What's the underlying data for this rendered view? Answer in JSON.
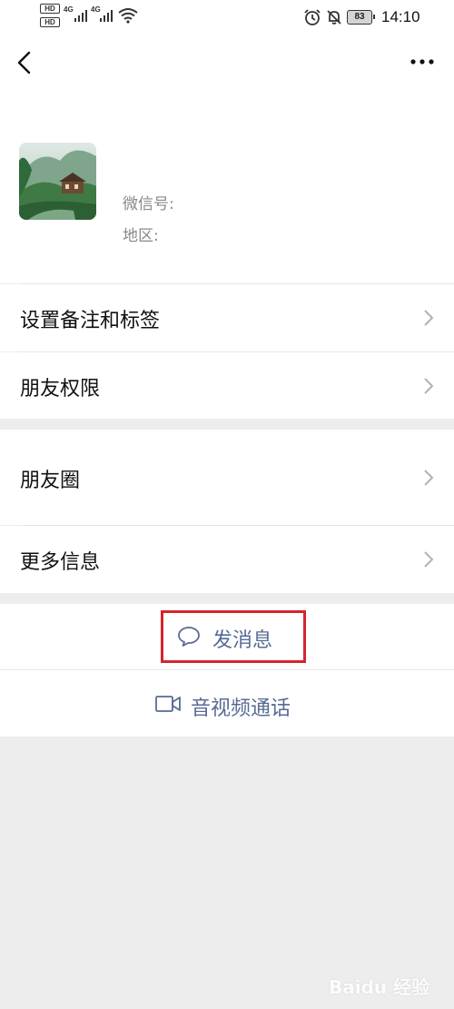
{
  "status_bar": {
    "hd_label": "HD",
    "network_1": "4G",
    "network_2": "4G",
    "battery": "83",
    "time": "14:10"
  },
  "header": {
    "back_icon": "chevron-left-icon",
    "more_icon": "more-dots-icon",
    "wechat_id_label": "微信号:",
    "region_label": "地区:"
  },
  "menu": {
    "group1": [
      {
        "label": "设置备注和标签",
        "icon": "chevron-right-icon"
      },
      {
        "label": "朋友权限",
        "icon": "chevron-right-icon"
      }
    ],
    "group2": [
      {
        "label": "朋友圈",
        "icon": "chevron-right-icon"
      },
      {
        "label": "更多信息",
        "icon": "chevron-right-icon"
      }
    ]
  },
  "actions": {
    "send_message": "发消息",
    "send_message_icon": "chat-bubble-icon",
    "video_call": "音视频通话",
    "video_call_icon": "video-camera-icon"
  },
  "watermark": {
    "text": "Baidu 经验"
  },
  "colors": {
    "background": "#ededed",
    "link_blue": "#576b95",
    "highlight_red": "#d4252b"
  }
}
